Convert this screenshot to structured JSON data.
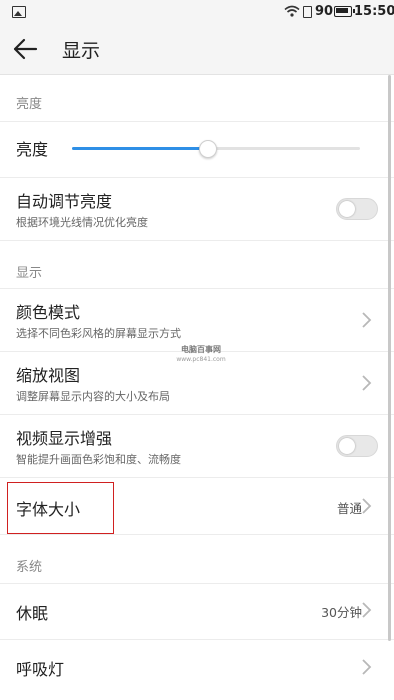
{
  "status_bar": {
    "battery_percent": "90",
    "time": "15:50"
  },
  "header": {
    "title": "显示"
  },
  "sections": {
    "brightness_header": "亮度",
    "display_header": "显示",
    "system_header": "系统"
  },
  "brightness": {
    "label": "亮度",
    "level_fraction": 0.47
  },
  "auto_brightness": {
    "title": "自动调节亮度",
    "subtitle": "根据环境光线情况优化亮度",
    "enabled": false
  },
  "color_mode": {
    "title": "颜色模式",
    "subtitle": "选择不同色彩风格的屏幕显示方式"
  },
  "zoom_view": {
    "title": "缩放视图",
    "subtitle": "调整屏幕显示内容的大小及布局"
  },
  "video_enhance": {
    "title": "视频显示增强",
    "subtitle": "智能提升画面色彩饱和度、流畅度",
    "enabled": false
  },
  "font_size": {
    "title": "字体大小",
    "value": "普通"
  },
  "sleep": {
    "title": "休眠",
    "value": "30分钟"
  },
  "breath_light": {
    "title": "呼吸灯"
  },
  "watermark": {
    "line1": "电脑百事网",
    "line2": "www.pc841.com"
  },
  "colors": {
    "accent": "#2e8fe6",
    "highlight_border": "#d02020"
  }
}
